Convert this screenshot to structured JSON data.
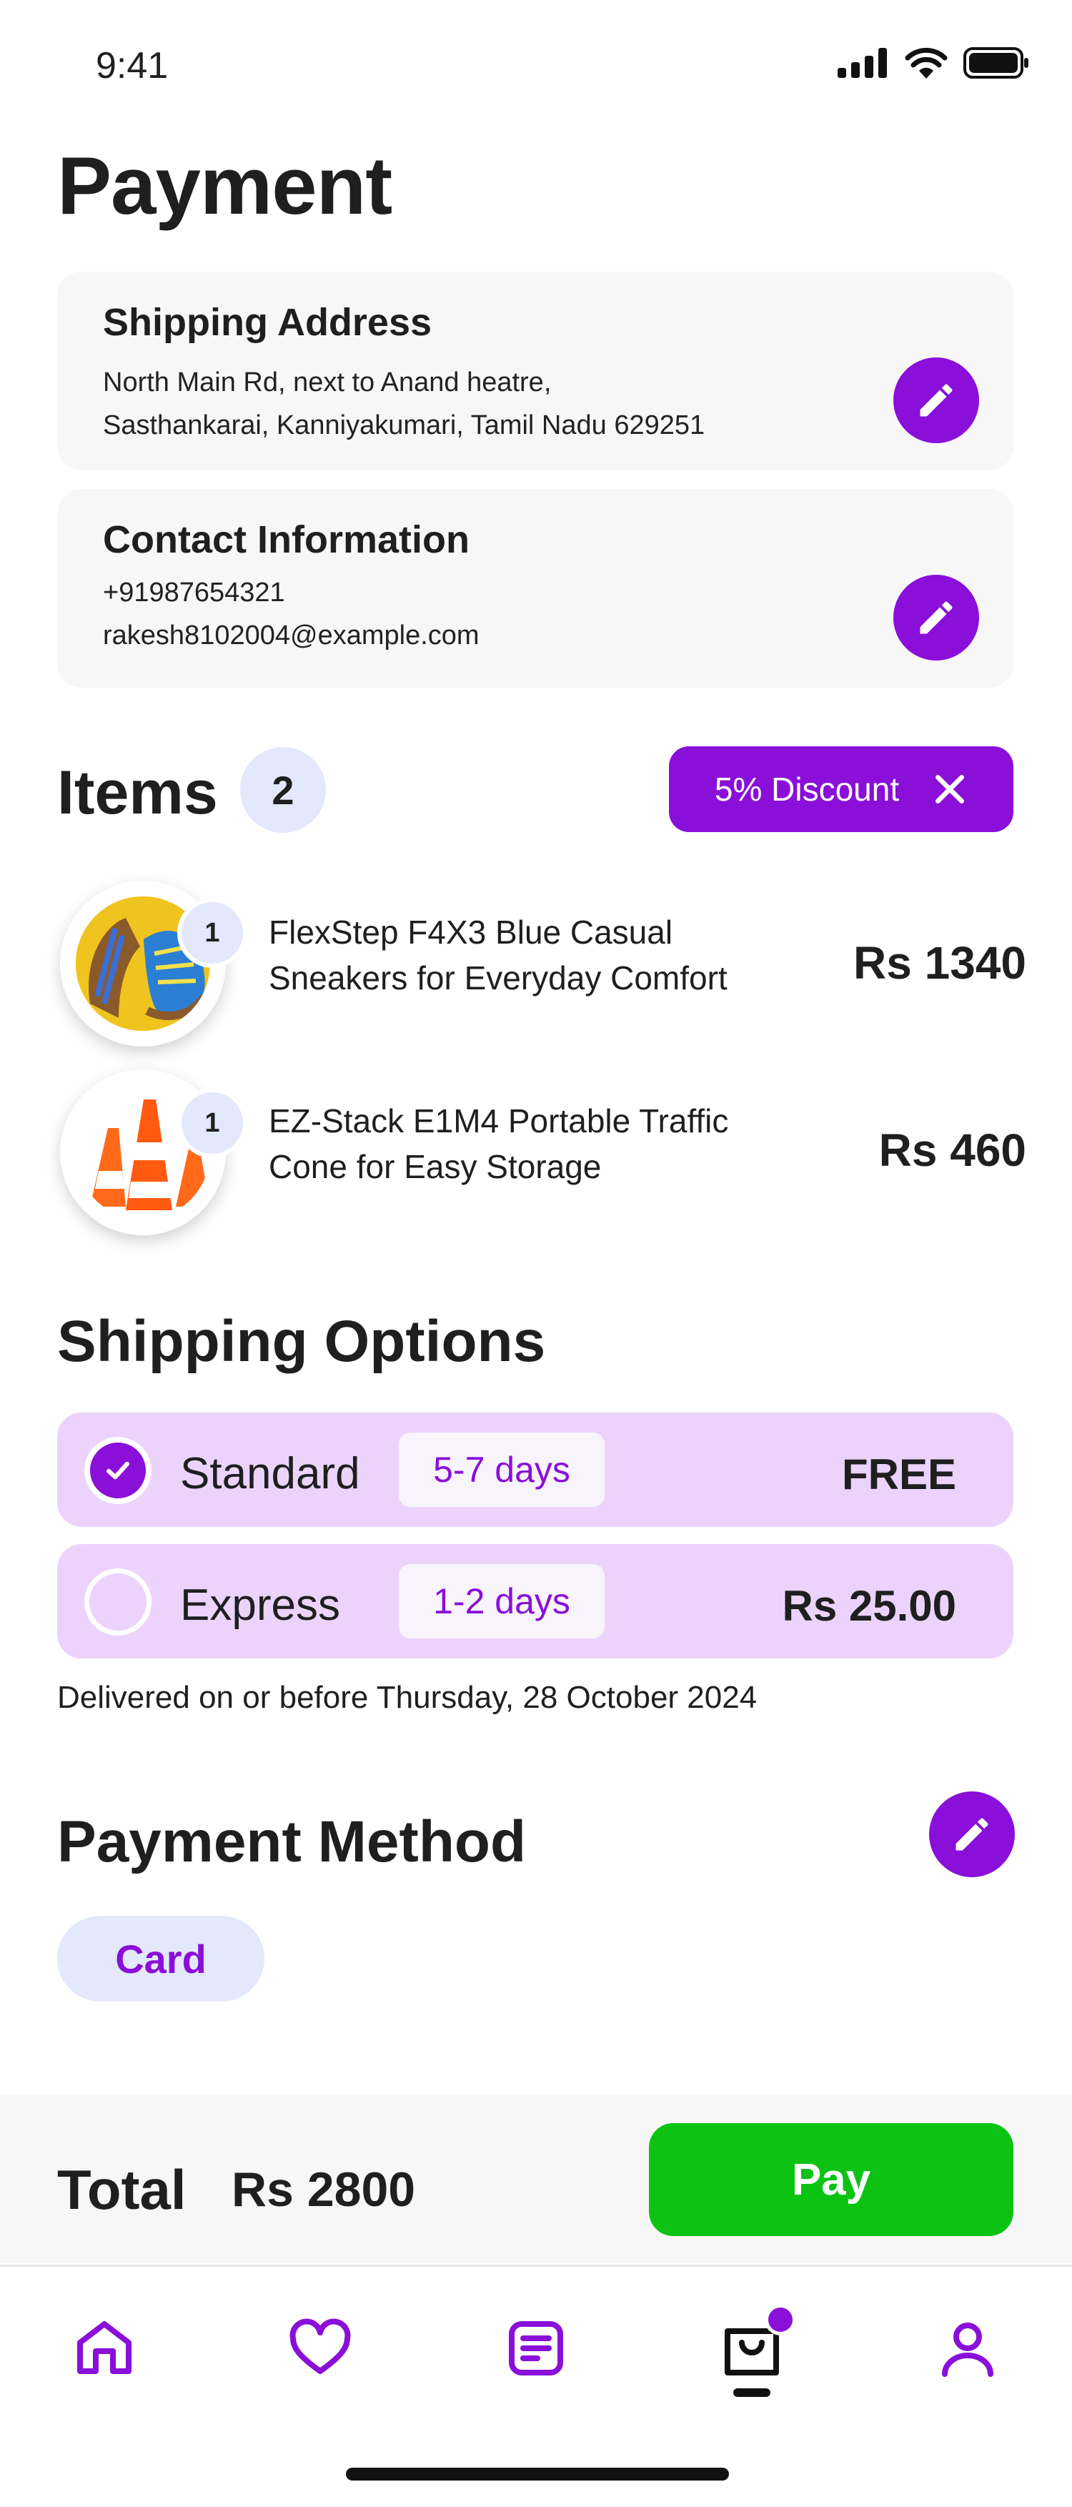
{
  "status_bar": {
    "time": "9:41"
  },
  "page_title": "Payment",
  "shipping_address": {
    "title": "Shipping Address",
    "line1": "North  Main Rd, next to Anand  heatre,",
    "line2": "Sasthankarai, Kanniyakumari, Tamil Nadu 629251"
  },
  "contact_info": {
    "title": "Contact Information",
    "phone": "+91987654321",
    "email": "rakesh8102004@example.com"
  },
  "items": {
    "title": "Items",
    "count": "2",
    "discount_label": "5% Discount",
    "list": [
      {
        "name_line1": "FlexStep F4X3 Blue Casual",
        "name_line2": "Sneakers for Everyday Comfort",
        "qty": "1",
        "price": "Rs 1340"
      },
      {
        "name_line1": "EZ-Stack E1M4 Portable Traffic",
        "name_line2": "Cone for Easy Storage",
        "qty": "1",
        "price": "Rs 460"
      }
    ]
  },
  "shipping_options": {
    "title": "Shipping Options",
    "options": [
      {
        "label": "Standard",
        "days": "5-7 days",
        "price": "FREE",
        "selected": true
      },
      {
        "label": "Express",
        "days": "1-2 days",
        "price": "Rs 25.00",
        "selected": false
      }
    ],
    "delivery_note": "Delivered on or before Thursday, 28 October 2024"
  },
  "payment_method": {
    "title": "Payment Method",
    "selected": "Card"
  },
  "total": {
    "label": "Total",
    "amount": "Rs 2800",
    "pay_label": "Pay"
  },
  "nav": {
    "items": [
      {
        "icon": "home-icon"
      },
      {
        "icon": "heart-icon"
      },
      {
        "icon": "list-icon"
      },
      {
        "icon": "shopping-bag-icon",
        "active": true
      },
      {
        "icon": "profile-icon"
      }
    ]
  },
  "colors": {
    "accent": "#8a0fd8",
    "pay_green": "#0cc313",
    "option_bg": "#ecd3fc",
    "badge_bg": "#e3e8fb"
  }
}
